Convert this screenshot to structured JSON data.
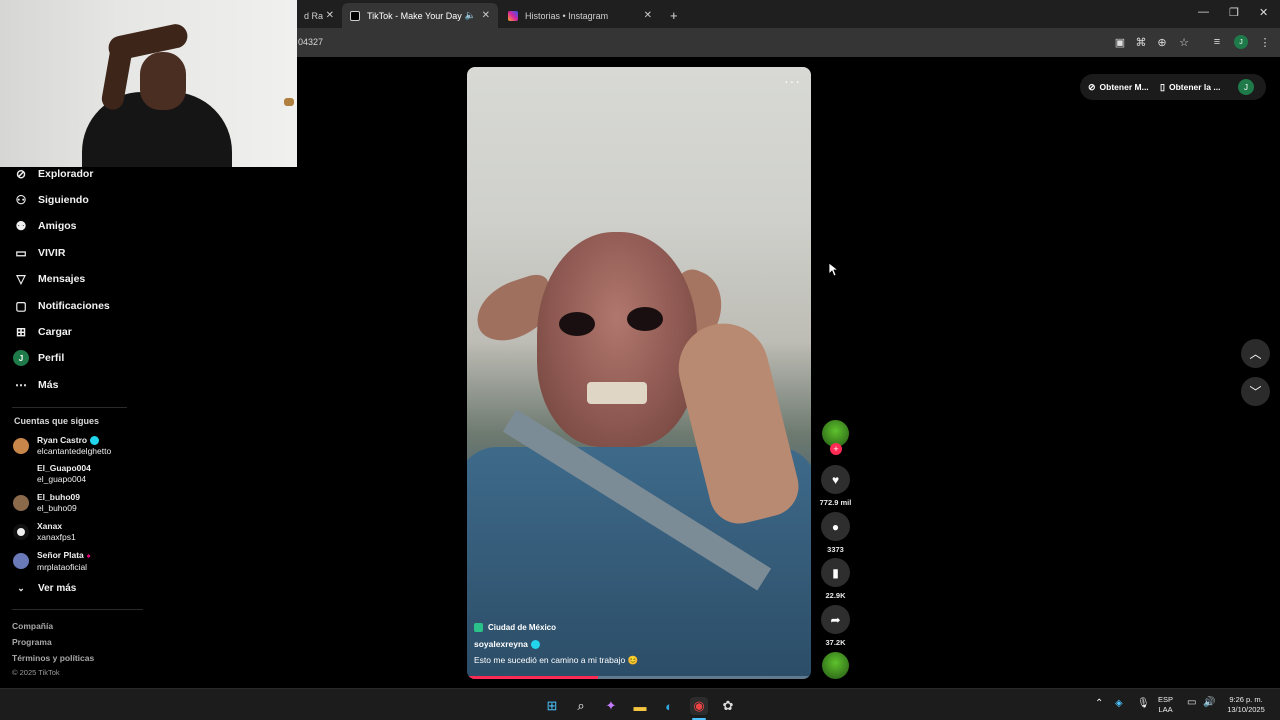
{
  "browser": {
    "tabs": [
      {
        "title": "d Ra",
        "favicon_color": "#c0392b",
        "active": false
      },
      {
        "title": "TikTok - Make Your Day",
        "favicon_color": "#111111",
        "active": true
      },
      {
        "title": "Historias • Instagram",
        "favicon_color": "#d6249f",
        "active": false
      }
    ],
    "url": "04327",
    "profile_initial": "J"
  },
  "sidebar": {
    "items": [
      {
        "label": "Explorador",
        "icon": "compass-icon",
        "glyph": "⊘"
      },
      {
        "label": "Siguiendo",
        "icon": "following-icon",
        "glyph": "⚇"
      },
      {
        "label": "Amigos",
        "icon": "friends-icon",
        "glyph": "⚉"
      },
      {
        "label": "VIVIR",
        "icon": "live-icon",
        "glyph": "▭"
      },
      {
        "label": "Mensajes",
        "icon": "messages-icon",
        "glyph": "▽"
      },
      {
        "label": "Notificaciones",
        "icon": "notifications-icon",
        "glyph": "▢"
      },
      {
        "label": "Cargar",
        "icon": "upload-icon",
        "glyph": "⊞"
      },
      {
        "label": "Perfil",
        "icon": "profile-avatar",
        "glyph": "J"
      },
      {
        "label": "Más",
        "icon": "more-icon",
        "glyph": "⋯"
      }
    ],
    "following_heading": "Cuentas que sigues",
    "accounts": [
      {
        "name": "Ryan Castro",
        "handle": "elcantantedelghetto",
        "verified": true,
        "color": "#c8864a"
      },
      {
        "name": "El_Guapo004",
        "handle": "el_guapo004",
        "verified": false,
        "color": ""
      },
      {
        "name": "El_buho09",
        "handle": "el_buho09",
        "verified": false,
        "color": "#8a6a4a"
      },
      {
        "name": "Xanax",
        "handle": "xanaxfps1",
        "verified": false,
        "color": "#f0f0f0"
      },
      {
        "name": "Señor Plata",
        "handle": "mrplataoficial",
        "verified": false,
        "color": "#6a7ab8"
      }
    ],
    "see_more": "Ver más",
    "footer_links": [
      "Compañía",
      "Programa",
      "Términos y políticas"
    ],
    "copyright": "© 2025 TikTok"
  },
  "video": {
    "location": "Ciudad de México",
    "username": "soyalexreyna",
    "caption": "Esto me sucedió en camino a mi trabajo 😊",
    "progress": 0.38
  },
  "actions": {
    "likes": "772.9 mil",
    "comments": "3373",
    "saves": "22.9K",
    "shares": "37.2K"
  },
  "top_right": {
    "btn1": "Obtener M...",
    "btn2": "Obtener la ...",
    "avatar": "J"
  },
  "taskbar": {
    "lang1": "ESP",
    "lang2": "LAA",
    "time": "9:26 p. m.",
    "date": "13/10/2025"
  },
  "colors": {
    "accent": "#fe2c55",
    "verified": "#20d5ec"
  }
}
